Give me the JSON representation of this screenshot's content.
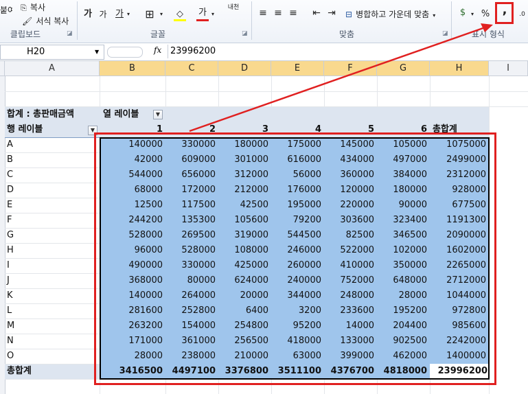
{
  "ribbon": {
    "clipboard": {
      "copy": "복사",
      "paste_partial": "붙여넣기",
      "format_painter": "서식 복사",
      "label": "클립보드"
    },
    "font": {
      "label": "글꼴",
      "grow": "가",
      "shrink": "가",
      "cycle": "가",
      "border": "⊞",
      "fill": "◇",
      "font_color": "가",
      "phonetic": "내천"
    },
    "alignment": {
      "merge_center": "병합하고 가운데 맞춤",
      "label": "맞춤"
    },
    "number": {
      "percent": "%",
      "comma": ",",
      "label": "표시 형식"
    }
  },
  "formula_bar": {
    "name_box": "H20",
    "fx": "fx",
    "value": "23996200"
  },
  "columns": [
    "A",
    "B",
    "C",
    "D",
    "E",
    "F",
    "G",
    "H",
    "I"
  ],
  "pivot": {
    "title": "합계 : 총판매금액",
    "column_label": "열 레이블",
    "row_label": "행 레이블",
    "col_headers": [
      "1",
      "2",
      "3",
      "4",
      "5",
      "6",
      "총합계"
    ],
    "rows": [
      {
        "label": "A",
        "values": [
          "140000",
          "330000",
          "180000",
          "175000",
          "145000",
          "105000",
          "1075000"
        ]
      },
      {
        "label": "B",
        "values": [
          "42000",
          "609000",
          "301000",
          "616000",
          "434000",
          "497000",
          "2499000"
        ]
      },
      {
        "label": "C",
        "values": [
          "544000",
          "656000",
          "312000",
          "56000",
          "360000",
          "384000",
          "2312000"
        ]
      },
      {
        "label": "D",
        "values": [
          "68000",
          "172000",
          "212000",
          "176000",
          "120000",
          "180000",
          "928000"
        ]
      },
      {
        "label": "E",
        "values": [
          "12500",
          "117500",
          "42500",
          "195000",
          "220000",
          "90000",
          "677500"
        ]
      },
      {
        "label": "F",
        "values": [
          "244200",
          "135300",
          "105600",
          "79200",
          "303600",
          "323400",
          "1191300"
        ]
      },
      {
        "label": "G",
        "values": [
          "528000",
          "269500",
          "319000",
          "544500",
          "82500",
          "346500",
          "2090000"
        ]
      },
      {
        "label": "H",
        "values": [
          "96000",
          "528000",
          "108000",
          "246000",
          "522000",
          "102000",
          "1602000"
        ]
      },
      {
        "label": "I",
        "values": [
          "490000",
          "330000",
          "425000",
          "260000",
          "410000",
          "350000",
          "2265000"
        ]
      },
      {
        "label": "J",
        "values": [
          "368000",
          "80000",
          "624000",
          "240000",
          "752000",
          "648000",
          "2712000"
        ]
      },
      {
        "label": "K",
        "values": [
          "140000",
          "264000",
          "20000",
          "344000",
          "248000",
          "28000",
          "1044000"
        ]
      },
      {
        "label": "L",
        "values": [
          "281600",
          "252800",
          "6400",
          "3200",
          "233600",
          "195200",
          "972800"
        ]
      },
      {
        "label": "M",
        "values": [
          "263200",
          "154000",
          "254800",
          "95200",
          "14000",
          "204400",
          "985600"
        ]
      },
      {
        "label": "N",
        "values": [
          "171000",
          "361000",
          "256500",
          "418000",
          "133000",
          "902500",
          "2242000"
        ]
      },
      {
        "label": "O",
        "values": [
          "28000",
          "238000",
          "210000",
          "63000",
          "399000",
          "462000",
          "1400000"
        ]
      }
    ],
    "total": {
      "label": "총합계",
      "values": [
        "3416500",
        "4497100",
        "3376800",
        "3511100",
        "4376700",
        "4818000",
        "23996200"
      ]
    }
  },
  "colors": {
    "highlight": "#9fc5ec",
    "annotation": "#e02020",
    "header_selected": "#f9d98e"
  }
}
